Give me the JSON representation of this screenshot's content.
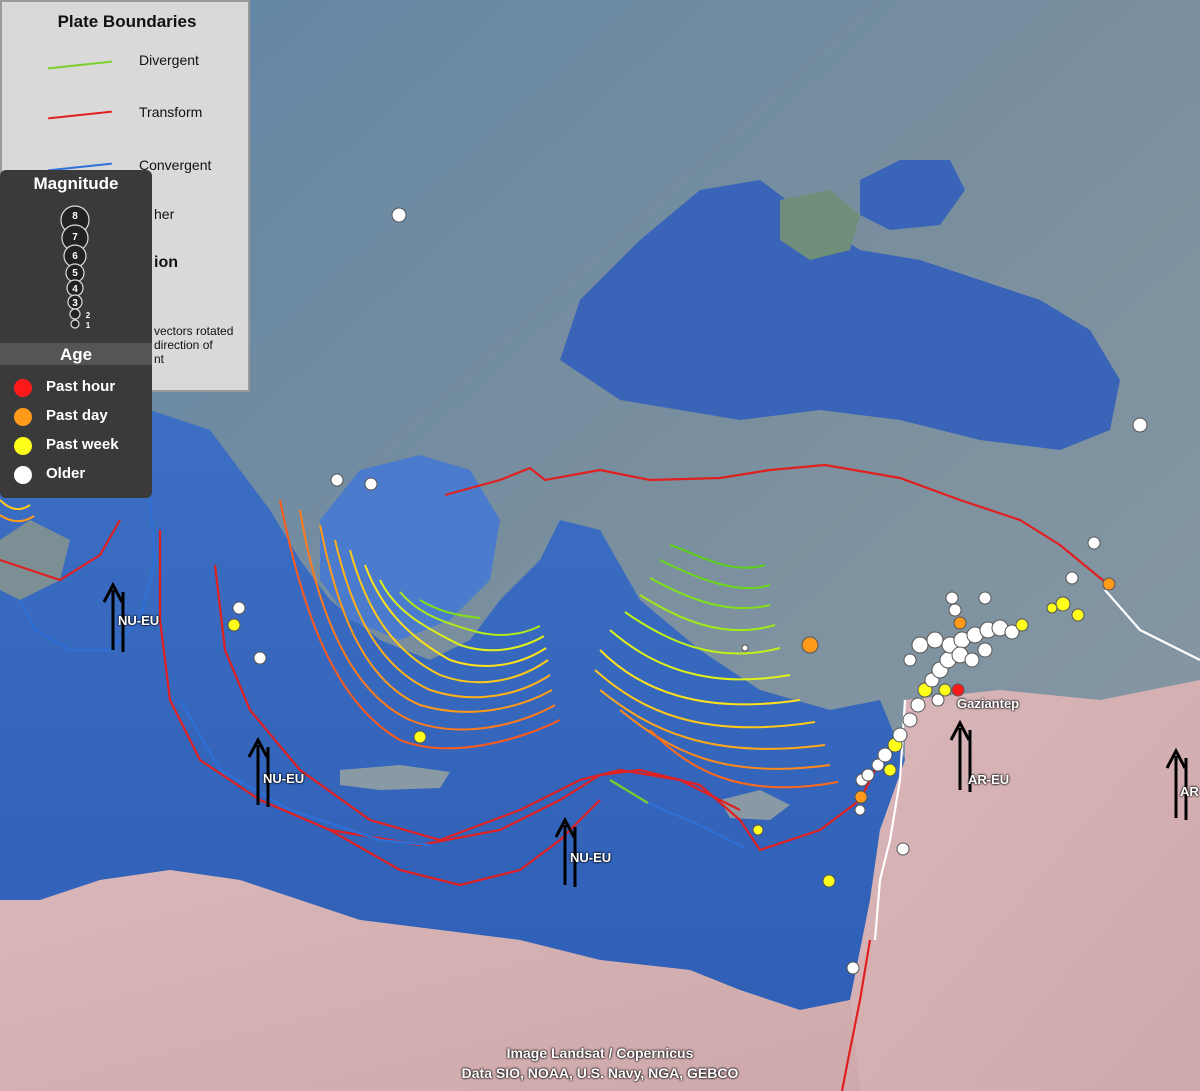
{
  "plate_boundaries": {
    "title": "Plate Boundaries",
    "items": [
      {
        "label": "Divergent",
        "color": "#7ccf2a"
      },
      {
        "label": "Transform",
        "color": "#e02020"
      },
      {
        "label": "Convergent",
        "color": "#2f6fd8"
      }
    ],
    "partial_other": "her",
    "partial_motion": "ion",
    "note_lines": [
      "vectors rotated",
      "direction of",
      "nt"
    ]
  },
  "magnitude": {
    "title": "Magnitude",
    "levels": [
      "8",
      "7",
      "6",
      "5",
      "4",
      "3",
      "2",
      "1"
    ]
  },
  "age": {
    "title": "Age",
    "items": [
      {
        "label": "Past hour",
        "color": "#ff1a1a"
      },
      {
        "label": "Past day",
        "color": "#ff9a1a"
      },
      {
        "label": "Past week",
        "color": "#ffff1a"
      },
      {
        "label": "Older",
        "color": "#ffffff"
      }
    ]
  },
  "plate_labels": [
    "NU-EU",
    "NU-EU",
    "NU-EU",
    "AR-EU",
    "AR"
  ],
  "city": "Gaziantep",
  "credits": {
    "line1": "Image Landsat / Copernicus",
    "line2": "Data SIO, NOAA, U.S. Navy, NGA, GEBCO"
  },
  "colors": {
    "sea": "#3b69c2",
    "land": "#6f8f9c",
    "desert": "#d8b8b8"
  }
}
